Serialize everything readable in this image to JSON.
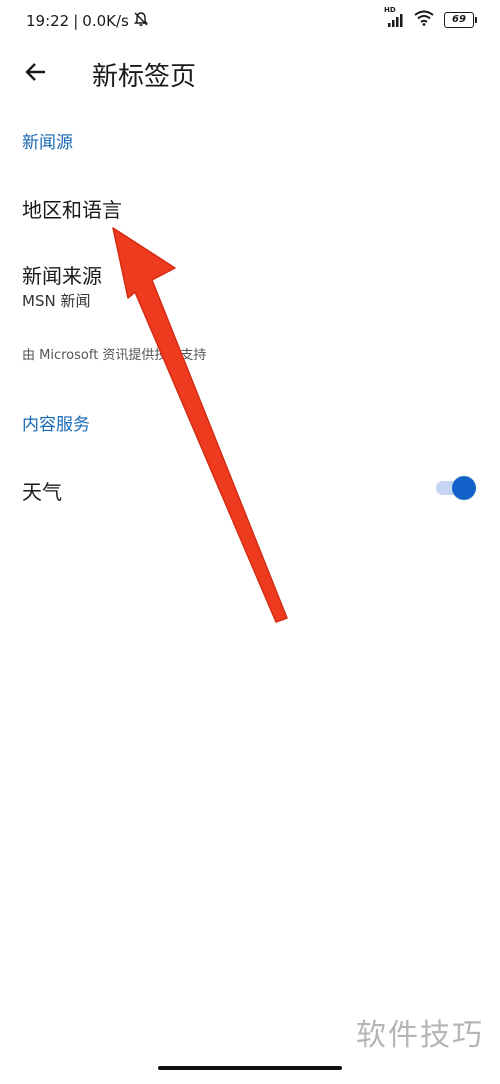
{
  "status_bar": {
    "time": "19:22",
    "separator": "|",
    "speed": "0.0K/s",
    "battery": "69",
    "hd_label": "HD"
  },
  "header": {
    "title": "新标签页"
  },
  "sections": {
    "news_source": {
      "header": "新闻源",
      "region_language": "地区和语言",
      "news_source_title": "新闻来源",
      "news_source_value": "MSN 新闻",
      "footnote": "由 Microsoft 资讯提供技术支持"
    },
    "content_services": {
      "header": "内容服务",
      "weather_label": "天气",
      "weather_enabled": true
    }
  },
  "watermark": "软件技巧",
  "colors": {
    "section_header": "#1769b5",
    "toggle_thumb": "#1462c9",
    "toggle_track": "#c6d6f2",
    "annotation_arrow": "#ee3a1f"
  }
}
